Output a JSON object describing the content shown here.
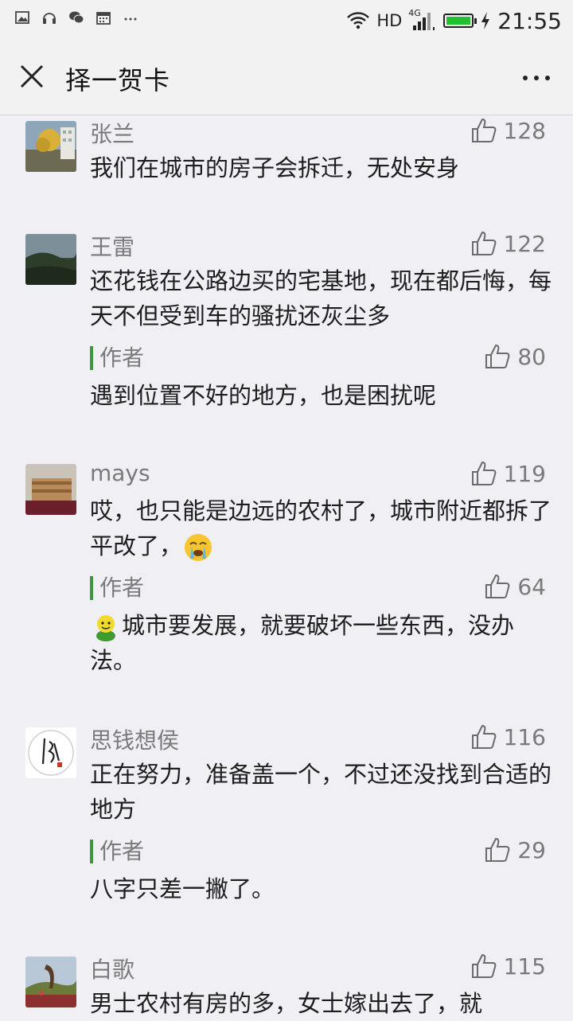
{
  "status_bar": {
    "network": "HD",
    "signal_type": "4G",
    "time": "21:55",
    "battery_level": 1.0,
    "battery_color": "#22c02b",
    "icons": [
      "image-icon",
      "headset-icon",
      "wechat-icon",
      "calendar-icon",
      "more-dots-icon",
      "wifi-icon",
      "signal-icon",
      "battery-icon",
      "charging-icon"
    ]
  },
  "header": {
    "title": "择一贺卡",
    "close_icon": "close-icon",
    "more_icon": "more-icon"
  },
  "comments": [
    {
      "name": "张兰",
      "likes": "128",
      "text": "我们在城市的房子会拆迁，无处安身"
    },
    {
      "name": "王雷",
      "likes": "122",
      "text": "还花钱在公路边买的宅基地，现在都后悔，每天不但受到车的骚扰还灰尘多",
      "reply": {
        "label": "作者",
        "likes": "80",
        "text": "遇到位置不好的地方，也是困扰呢"
      }
    },
    {
      "name": "mays",
      "likes": "119",
      "text": "哎，也只能是边远的农村了，城市附近都拆了平改了，",
      "reply": {
        "label": "作者",
        "likes": "64",
        "text": "城市要发展，就要破坏一些东西，没办法。"
      }
    },
    {
      "name": "思钱想侯",
      "likes": "116",
      "text": "正在努力，准备盖一个，不过还没找到合适的地方",
      "reply": {
        "label": "作者",
        "likes": "29",
        "text": "八字只差一撇了。"
      }
    },
    {
      "name": "白歌",
      "likes": "115",
      "text": "男士农村有房的多，女士嫁出去了，就"
    }
  ]
}
